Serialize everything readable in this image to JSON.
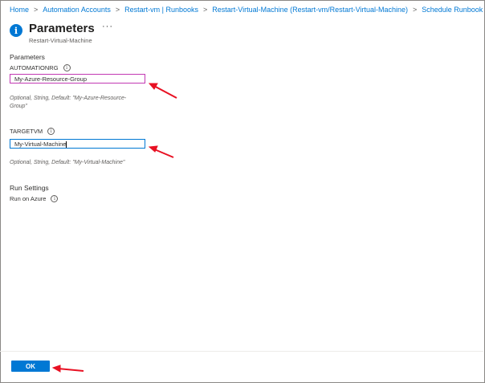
{
  "breadcrumb": [
    {
      "label": "Home"
    },
    {
      "label": "Automation Accounts"
    },
    {
      "label": "Restart-vm | Runbooks"
    },
    {
      "label": "Restart-Virtual-Machine (Restart-vm/Restart-Virtual-Machine)"
    },
    {
      "label": "Schedule Runbook"
    }
  ],
  "breadcrumb_separator": ">",
  "header": {
    "title": "Parameters",
    "subtitle": "Restart-Virtual-Machine",
    "more_label": "···",
    "info_glyph": "i"
  },
  "parameters": {
    "section_label": "Parameters",
    "automationrg": {
      "label": "AUTOMATIONRG",
      "value": "My-Azure-Resource-Group",
      "help_line1": "Optional, String, Default: \"My-Azure-Resource-",
      "help_line2": "Group\""
    },
    "targetvm": {
      "label": "TARGETVM",
      "value": "My-Virtual-Machine",
      "help": "Optional, String, Default: \"My-Virtual-Machine\""
    }
  },
  "run_settings": {
    "section_label": "Run Settings",
    "run_on_label": "Run on Azure"
  },
  "footer": {
    "ok_label": "OK"
  },
  "colors": {
    "accent": "#0078d4",
    "focus_border_rg": "#c239b3",
    "annotation_arrow": "#e81123"
  },
  "icons": {
    "info": "info-icon",
    "more": "more-icon",
    "annotation": "red-arrow-icon"
  }
}
